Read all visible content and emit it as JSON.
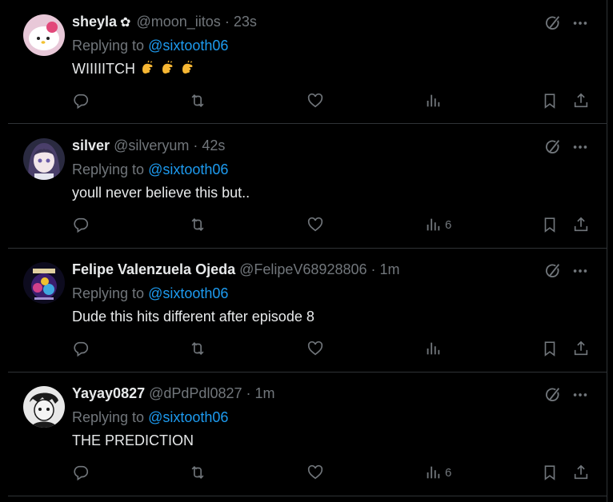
{
  "colors": {
    "background": "#000000",
    "text": "#e7e9ea",
    "muted": "#71767b",
    "link": "#1d9bf0",
    "divider": "#2f3336"
  },
  "replies": [
    {
      "name": "sheyla",
      "badge": "✿",
      "handle": "@moon_iitos",
      "separator": "·",
      "time": "23s",
      "replying_prefix": "Replying to",
      "mention": "@sixtooth06",
      "text": "WIIIIITCH",
      "emojis": [
        "clap-hand-emoji",
        "clap-hand-emoji",
        "clap-hand-emoji"
      ],
      "views": ""
    },
    {
      "name": "silver",
      "handle": "@silveryum",
      "separator": "·",
      "time": "42s",
      "replying_prefix": "Replying to",
      "mention": "@sixtooth06",
      "text": "youll never believe this but..",
      "views": "6"
    },
    {
      "name": "Felipe Valenzuela Ojeda",
      "handle": "@FelipeV68928806",
      "separator": "·",
      "time": "1m",
      "replying_prefix": "Replying to",
      "mention": "@sixtooth06",
      "text": "Dude this hits different after episode 8",
      "views": ""
    },
    {
      "name": "Yayay0827",
      "handle": "@dPdPdl0827",
      "separator": "·",
      "time": "1m",
      "replying_prefix": "Replying to",
      "mention": "@sixtooth06",
      "text": "THE PREDICTION",
      "views": "6"
    }
  ],
  "icons": [
    "grok-icon",
    "more-icon",
    "reply-icon",
    "retweet-icon",
    "like-icon",
    "views-icon",
    "bookmark-icon",
    "share-icon"
  ]
}
